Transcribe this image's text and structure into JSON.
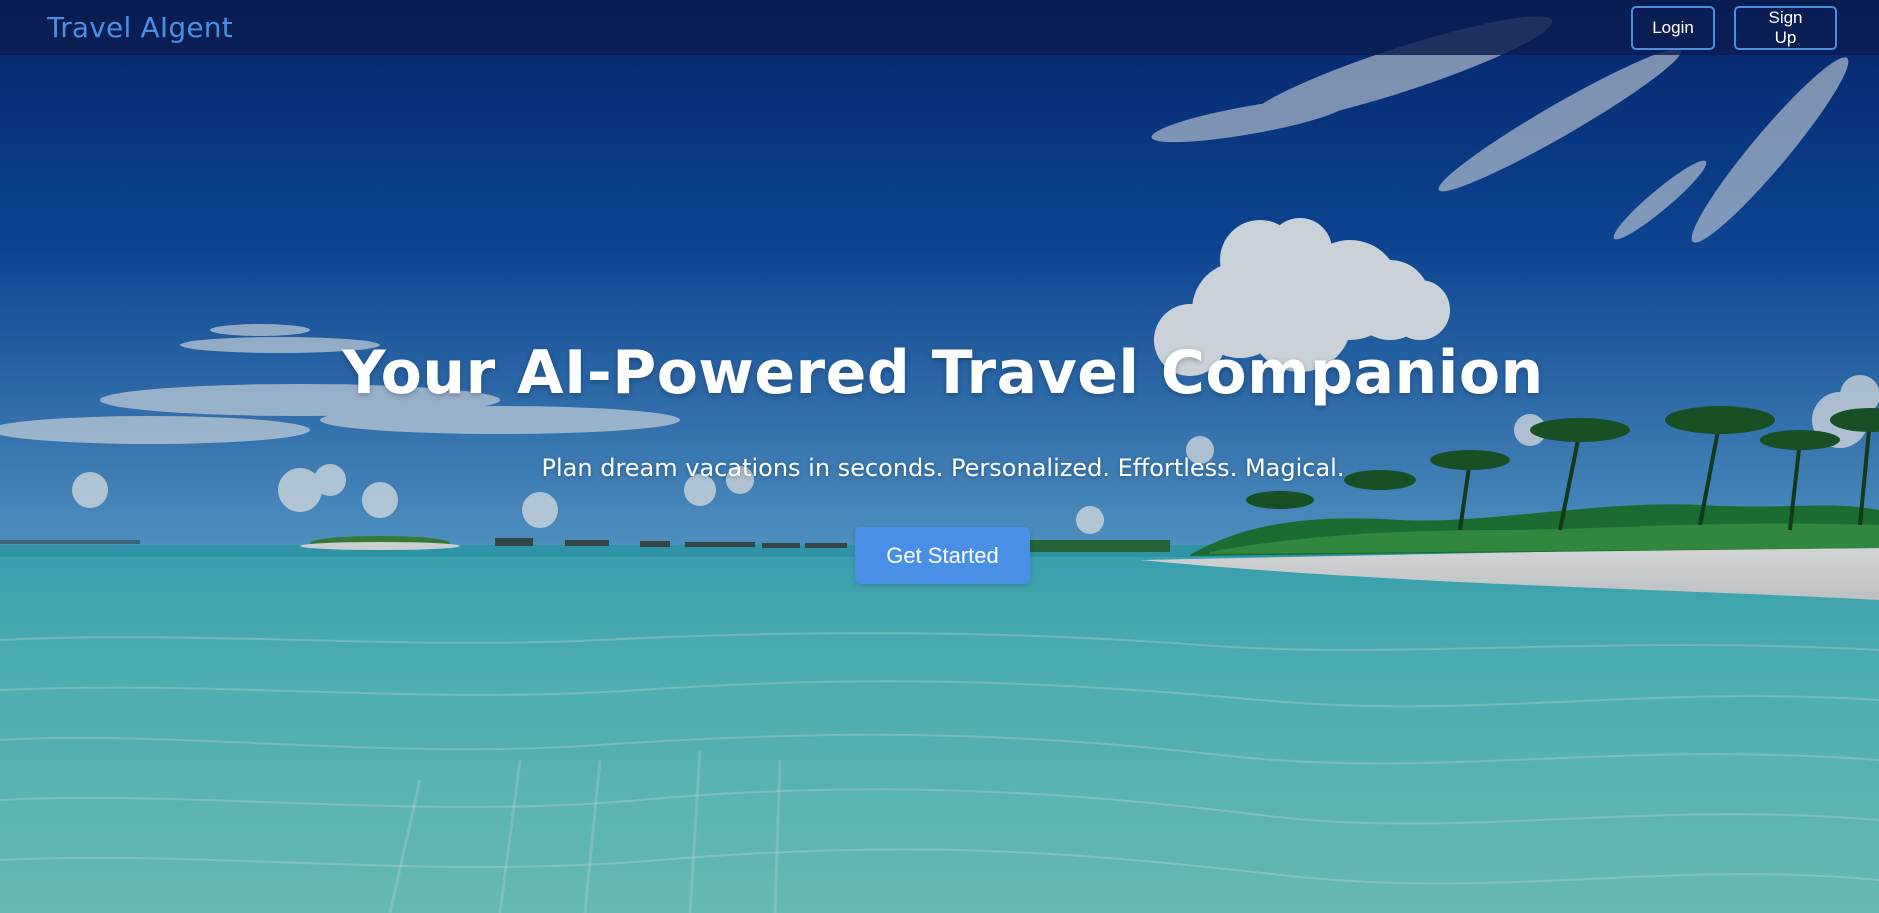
{
  "nav": {
    "brand": "Travel AIgent",
    "login_label": "Login",
    "signup_label": "Sign Up"
  },
  "hero": {
    "title": "Your AI-Powered Travel Companion",
    "subtitle": "Plan dream vacations in seconds. Personalized. Effortless. Magical.",
    "cta_label": "Get Started",
    "background_image": "tropical-beach-lagoon"
  },
  "colors": {
    "brand": "#4a8fe2",
    "accent": "#4a8fe6",
    "nav_background": "#0c1c4e",
    "text": "#ffffff"
  }
}
